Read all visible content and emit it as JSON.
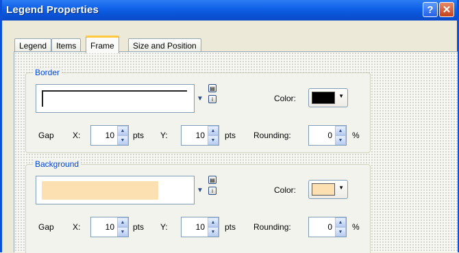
{
  "window": {
    "title": "Legend Properties",
    "help_label": "?",
    "close_label": "✕"
  },
  "tabs": [
    {
      "label": "Legend"
    },
    {
      "label": "Items"
    },
    {
      "label": "Frame"
    },
    {
      "label": "Size and Position"
    }
  ],
  "active_tab": "Frame",
  "border": {
    "title": "Border",
    "color_label": "Color:",
    "color_value": "#000000",
    "gap_label": "Gap",
    "x_label": "X:",
    "x_value": "10",
    "y_label": "Y:",
    "y_value": "10",
    "pts": "pts",
    "rounding_label": "Rounding:",
    "rounding_value": "0",
    "percent": "%"
  },
  "background": {
    "title": "Background",
    "color_label": "Color:",
    "color_value": "#FCE0B2",
    "gap_label": "Gap",
    "x_label": "X:",
    "x_value": "10",
    "y_label": "Y:",
    "y_value": "10",
    "pts": "pts",
    "rounding_label": "Rounding:",
    "rounding_value": "0",
    "percent": "%"
  },
  "icons": {
    "dropdown": "chevron-down-icon",
    "properties": "properties-icon",
    "info": "info-icon",
    "spin_up": "spin-up-icon",
    "spin_down": "spin-down-icon"
  }
}
